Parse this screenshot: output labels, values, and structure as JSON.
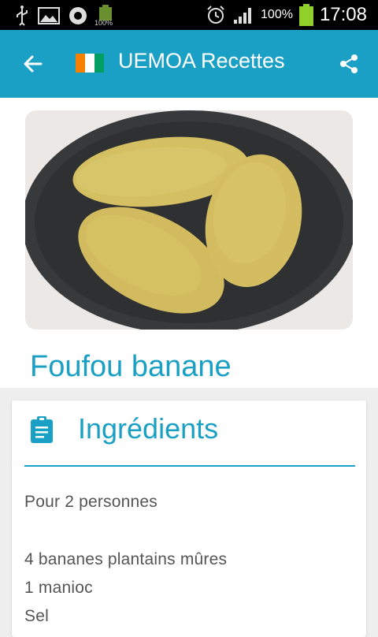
{
  "status_bar": {
    "battery_small_label": "100%",
    "battery_percent": "100%",
    "time": "17:08"
  },
  "app_bar": {
    "title": "UEMOA Recettes",
    "flag_colors": [
      "#f77f00",
      "#ffffff",
      "#009e60"
    ]
  },
  "recipe": {
    "title": "Foufou banane"
  },
  "ingredients": {
    "heading": "Ingrédients",
    "servings": "Pour 2 personnes",
    "items": [
      "4 bananes plantains mûres",
      "1 manioc",
      "Sel"
    ]
  },
  "colors": {
    "accent": "#1aa0c4"
  }
}
